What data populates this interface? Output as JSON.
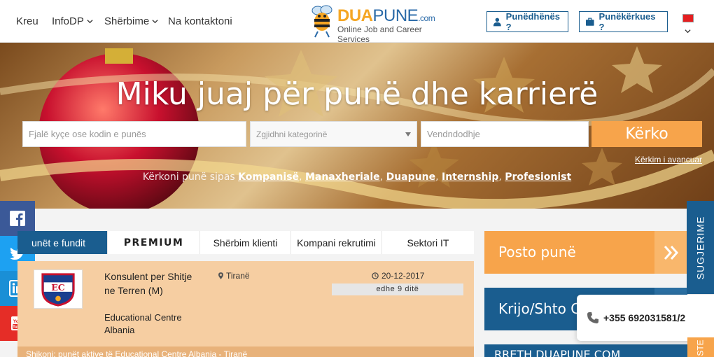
{
  "nav": {
    "items": [
      {
        "label": "Kreu",
        "dropdown": false
      },
      {
        "label": "InfoDP",
        "dropdown": true
      },
      {
        "label": "Shërbime",
        "dropdown": true
      },
      {
        "label": "Na kontaktoni",
        "dropdown": false
      }
    ],
    "logo": {
      "brand_a": "DUA",
      "brand_b": "PUNE",
      "brand_c": ".com",
      "tagline": "Online Job and Career Services"
    },
    "employer_button": "Punëdhënës ?",
    "seeker_button": "Punëkërkues ?",
    "language": "Shqip"
  },
  "hero": {
    "title": "Miku juaj për punë dhe karrierë",
    "keyword_placeholder": "Fjalë kyçe ose kodin e punës",
    "category_placeholder": "Zgjidhni kategorinë",
    "location_placeholder": "Vendndodhje",
    "search_button": "Kërko",
    "advanced_search": "Kërkim i avancuar",
    "browse_prefix": "Kërkoni punë sipas",
    "browse_links": [
      "Kompanisë",
      "Manaxheriale",
      "Duapune",
      "Internship",
      "Profesionist"
    ]
  },
  "social": [
    {
      "name": "facebook",
      "color": "#3b5998"
    },
    {
      "name": "twitter",
      "color": "#1da1f2"
    },
    {
      "name": "linkedin",
      "color": "#1a8fd6"
    },
    {
      "name": "youtube",
      "color": "#e52d27"
    }
  ],
  "tabs": [
    "unët e fundit",
    "PREMIUM",
    "Shërbim klienti",
    "Kompani rekrutimi",
    "Sektori IT"
  ],
  "active_tab": 0,
  "job": {
    "logo_text": "EC",
    "title": "Konsulent per Shitje ne Terren (M)",
    "company": "Educational Centre Albania",
    "location": "Tiranë",
    "date": "20-12-2017",
    "remaining": "edhe 9 ditë",
    "footer": "Shikoni: punët aktive të Educational Centre Albania - Tiranë"
  },
  "sidebar": {
    "post_job": "Posto punë",
    "create_cv": "Krijo/Shto CV",
    "about": "RRETH DUAPUNE.COM"
  },
  "phone": "+355 692031581/2",
  "feedback_tab": "SUGJERIME",
  "bottom_tab": "STE",
  "colors": {
    "primary": "#1a5d8f",
    "accent": "#f7a44b",
    "job_card": "#f6cea2"
  }
}
